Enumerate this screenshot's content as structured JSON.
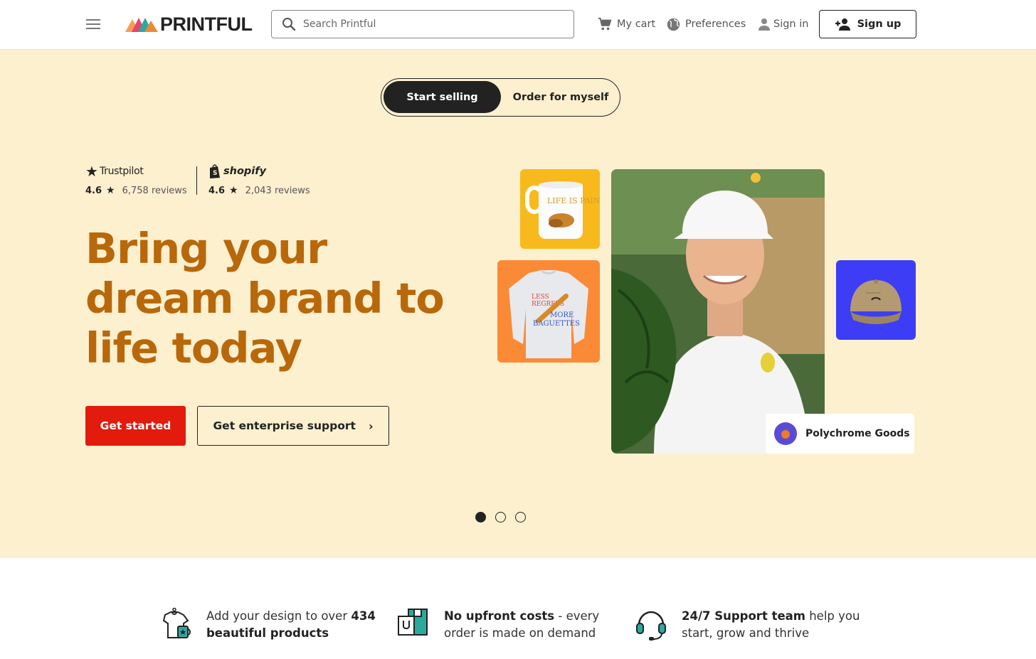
{
  "header": {
    "logo_text": "PRINTFUL",
    "search_placeholder": "Search Printful",
    "nav": {
      "cart": "My cart",
      "preferences": "Preferences",
      "signin": "Sign in",
      "signup": "Sign up"
    }
  },
  "hero": {
    "toggle": {
      "active": "Start selling",
      "inactive": "Order for myself"
    },
    "ratings": [
      {
        "brand": "Trustpilot",
        "score": "4.6",
        "reviews": "6,758 reviews"
      },
      {
        "brand": "shopify",
        "score": "4.6",
        "reviews": "2,043 reviews"
      }
    ],
    "headline_lines": [
      "Bring your",
      "dream brand to",
      "life today"
    ],
    "cta_primary": "Get started",
    "cta_secondary": "Get enterprise support",
    "brand_card": "Polychrome Goods",
    "carousel_active": 1,
    "carousel_total": 3
  },
  "features": [
    {
      "pre": "Add your design to over ",
      "bold": "434",
      "post": "",
      "line2_bold": "beautiful products",
      "line2": ""
    },
    {
      "pre": "",
      "bold": "No upfront costs",
      "post": " - every",
      "line2_bold": "",
      "line2": "order is made on demand"
    },
    {
      "pre": "",
      "bold": "24/7 Support team",
      "post": " help you",
      "line2_bold": "",
      "line2": "start, grow and thrive"
    }
  ],
  "colors": {
    "hero_bg": "#fdf0cf",
    "headline": "#b8680a",
    "primary_cta": "#e31b0c"
  }
}
